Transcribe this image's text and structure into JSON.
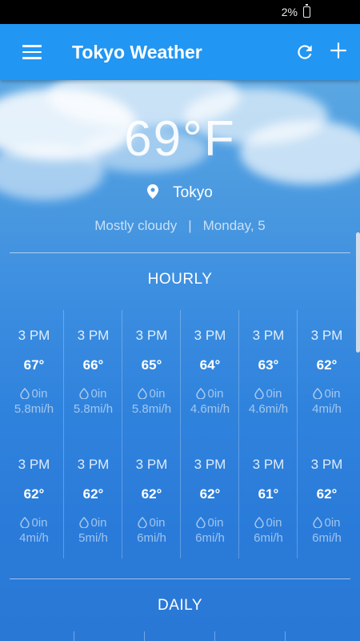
{
  "status_bar": {
    "battery": "2%"
  },
  "app_bar": {
    "title": "Tokyo Weather"
  },
  "current": {
    "temperature": "69°F",
    "location": "Tokyo",
    "condition": "Mostly cloudy",
    "separator": "|",
    "date": "Monday, 5"
  },
  "hourly": {
    "title": "HOURLY",
    "rows": [
      [
        {
          "time": "3 PM",
          "temp": "67°",
          "precip": "0in",
          "wind": "5.8mi/h"
        },
        {
          "time": "3 PM",
          "temp": "66°",
          "precip": "0in",
          "wind": "5.8mi/h"
        },
        {
          "time": "3 PM",
          "temp": "65°",
          "precip": "0in",
          "wind": "5.8mi/h"
        },
        {
          "time": "3 PM",
          "temp": "64°",
          "precip": "0in",
          "wind": "4.6mi/h"
        },
        {
          "time": "3 PM",
          "temp": "63°",
          "precip": "0in",
          "wind": "4.6mi/h"
        },
        {
          "time": "3 PM",
          "temp": "62°",
          "precip": "0in",
          "wind": "4mi/h"
        }
      ],
      [
        {
          "time": "3 PM",
          "temp": "62°",
          "precip": "0in",
          "wind": "4mi/h"
        },
        {
          "time": "3 PM",
          "temp": "62°",
          "precip": "0in",
          "wind": "5mi/h"
        },
        {
          "time": "3 PM",
          "temp": "62°",
          "precip": "0in",
          "wind": "6mi/h"
        },
        {
          "time": "3 PM",
          "temp": "62°",
          "precip": "0in",
          "wind": "6mi/h"
        },
        {
          "time": "3 PM",
          "temp": "61°",
          "precip": "0in",
          "wind": "6mi/h"
        },
        {
          "time": "3 PM",
          "temp": "62°",
          "precip": "0in",
          "wind": "6mi/h"
        }
      ]
    ]
  },
  "daily": {
    "title": "DAILY"
  },
  "colors": {
    "app_bar": "#2196f3",
    "sky": "#3b8de0"
  },
  "icons": {
    "menu": "menu-icon",
    "refresh": "refresh-icon",
    "add": "add-icon",
    "location": "location-pin-icon",
    "precip": "water-drop-icon",
    "battery": "battery-icon"
  }
}
